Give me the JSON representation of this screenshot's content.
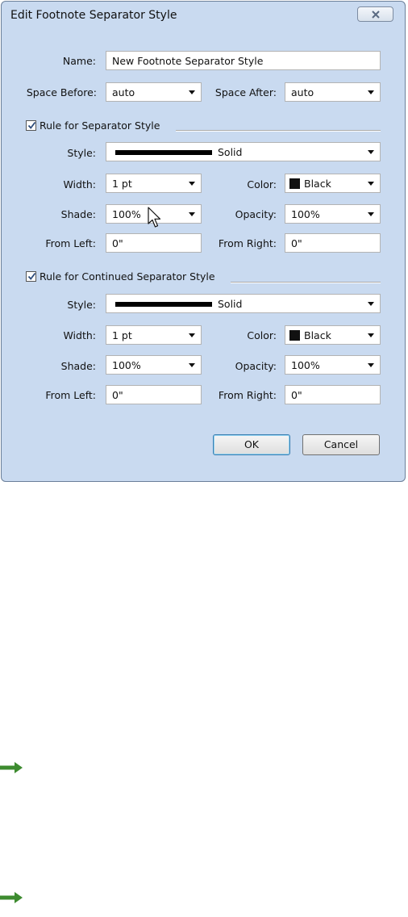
{
  "dialog": {
    "title": "Edit Footnote Separator Style",
    "close_icon": "close-icon",
    "name_label": "Name:",
    "name_value": "New Footnote Separator Style",
    "space_before_label": "Space Before:",
    "space_before_value": "auto",
    "space_after_label": "Space After:",
    "space_after_value": "auto",
    "ok_label": "OK",
    "cancel_label": "Cancel"
  },
  "separator_rule": {
    "checkbox_label": "Rule for Separator Style",
    "checked": true,
    "style_label": "Style:",
    "style_value": "Solid",
    "width_label": "Width:",
    "width_value": "1 pt",
    "color_label": "Color:",
    "color_value": "Black",
    "color_hex": "#111111",
    "shade_label": "Shade:",
    "shade_value": "100%",
    "opacity_label": "Opacity:",
    "opacity_value": "100%",
    "from_left_label": "From Left:",
    "from_left_value": "0\"",
    "from_right_label": "From Right:",
    "from_right_value": "0\""
  },
  "continued_rule": {
    "checkbox_label": "Rule for Continued Separator Style",
    "checked": true,
    "style_label": "Style:",
    "style_value": "Solid",
    "width_label": "Width:",
    "width_value": "1 pt",
    "color_label": "Color:",
    "color_value": "Black",
    "color_hex": "#111111",
    "shade_label": "Shade:",
    "shade_value": "100%",
    "opacity_label": "Opacity:",
    "opacity_value": "100%",
    "from_left_label": "From Left:",
    "from_left_value": "0\"",
    "from_right_label": "From Right:",
    "from_right_value": "0\""
  },
  "decorations": {
    "arrow_color": "#3d8b2f",
    "arrow_icon": "green-arrow-icon"
  }
}
